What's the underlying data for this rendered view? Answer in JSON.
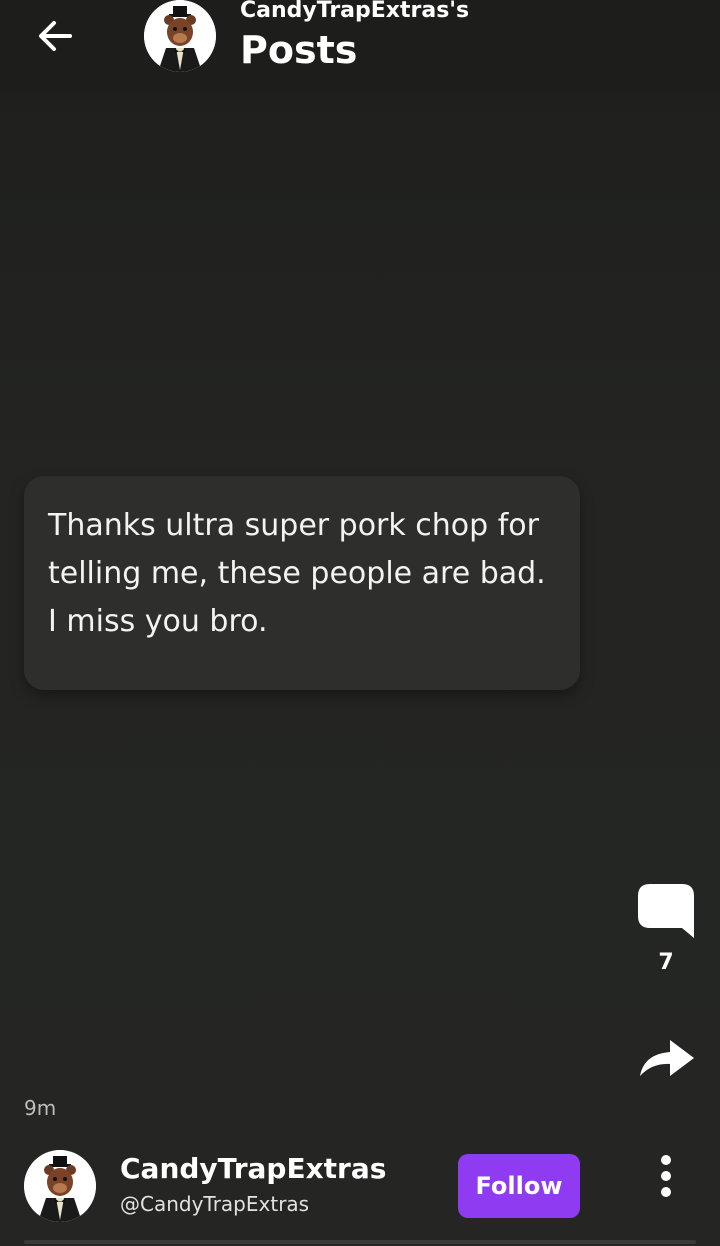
{
  "header": {
    "owner_label": "CandyTrapExtras's",
    "title": "Posts"
  },
  "post": {
    "text": "Thanks ultra super pork chop for telling me, these people are bad. I miss you bro.",
    "comment_count": "7",
    "timestamp": "9m"
  },
  "author": {
    "name": "CandyTrapExtras",
    "handle": "@CandyTrapExtras",
    "follow_label": "Follow"
  },
  "icons": {
    "back": "arrow-left-icon",
    "comment": "speech-bubble-icon",
    "share": "share-arrow-icon",
    "more": "vertical-dots-icon"
  },
  "colors": {
    "background": "#242522",
    "card": "#2e2f2c",
    "accent": "#8e3bf2"
  }
}
